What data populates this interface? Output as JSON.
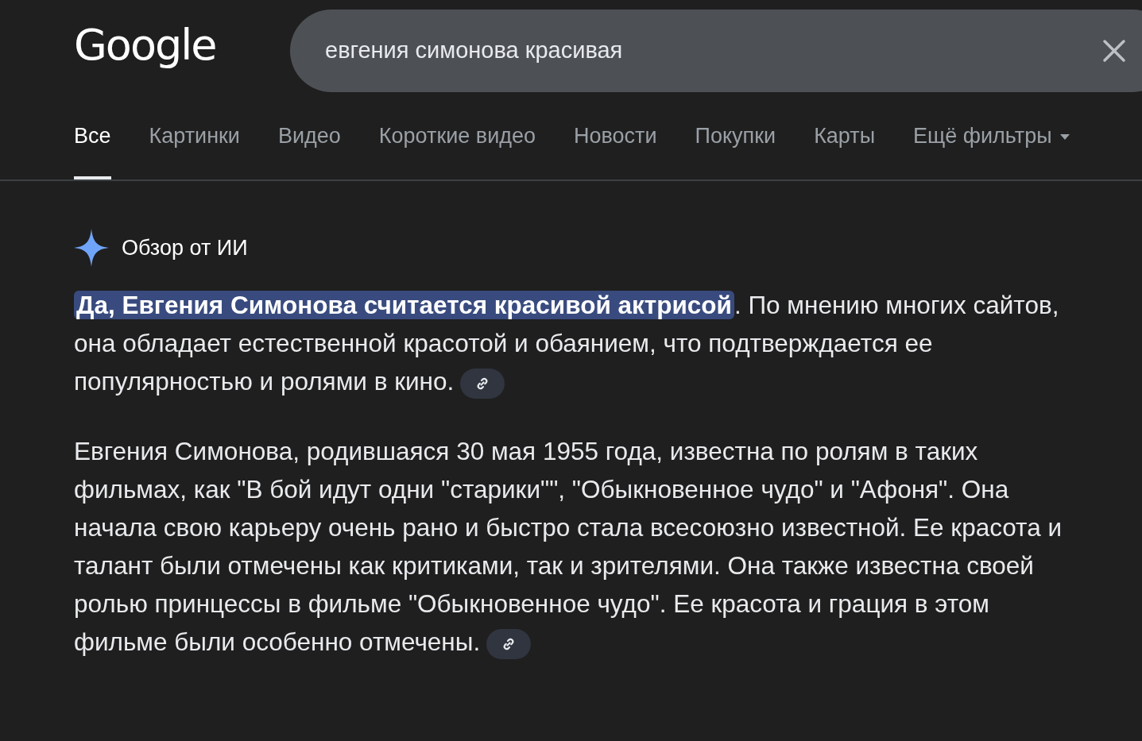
{
  "logo": "Google",
  "search": {
    "value": "евгения симонова красивая"
  },
  "tabs": [
    {
      "label": "Все",
      "selected": true
    },
    {
      "label": "Картинки",
      "selected": false
    },
    {
      "label": "Видео",
      "selected": false
    },
    {
      "label": "Короткие видео",
      "selected": false
    },
    {
      "label": "Новости",
      "selected": false
    },
    {
      "label": "Покупки",
      "selected": false
    },
    {
      "label": "Карты",
      "selected": false
    },
    {
      "label": "Ещё фильтры",
      "selected": false,
      "has_menu": true
    }
  ],
  "ai_overview": {
    "title": "Обзор от ИИ",
    "paragraphs": [
      {
        "segments": [
          {
            "text": "Да, Евгения Симонова считается красивой актрисой",
            "highlighted": true
          },
          {
            "text": ". По мнению многих сайтов, она обладает естественной красотой и обаянием, что подтверждается ее популярностью и ролями в кино.",
            "highlighted": false
          }
        ],
        "has_link": true
      },
      {
        "segments": [
          {
            "text": "Евгения Симонова, родившаяся 30 мая 1955 года, известна по ролям в таких фильмах, как \"В бой идут одни \"старики\"\", \"Обыкновенное чудо\" и \"Афоня\". Она начала свою карьеру очень рано и быстро стала всесоюзно известной. Ее красота и талант были отмечены как критиками, так и зрителями. Она также известна своей ролью принцессы в фильме \"Обыкновенное чудо\". Ее красота и грация в этом фильме были особенно отмечены.",
            "highlighted": false
          }
        ],
        "has_link": true
      }
    ]
  }
}
